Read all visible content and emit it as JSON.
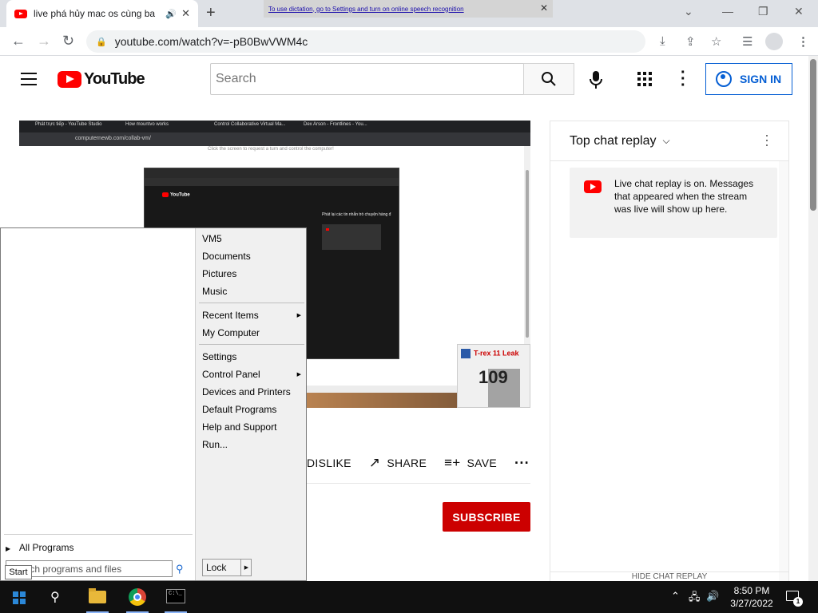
{
  "browser": {
    "tab_title": "live phá hủy mac os cùng ba",
    "dictation_notice": "To use dictation, go to Settings and turn on online speech recognition",
    "url": "youtube.com/watch?v=-pB0BwVWM4c"
  },
  "youtube": {
    "logo_text": "YouTube",
    "search_placeholder": "Search",
    "signin_label": "SIGN IN"
  },
  "video": {
    "inner_tabs": [
      "Phát trực tiếp - YouTube Studio",
      "How mountvo works",
      "Control Collaborative Virtual Ma...",
      "Dex Arson - Frontlines - You..."
    ],
    "inner_url": "computernewb.com/collab-vm/",
    "hint": "Click the screen to request a turn and control the computer!",
    "nested_yt_title": "Phát lại các tin nhắn trò chuyện hàng đ",
    "thumb_title": "T-rex 11 Leak",
    "thumb_number": "109"
  },
  "actions": {
    "dislike": "DISLIKE",
    "share": "SHARE",
    "save": "SAVE"
  },
  "subscribe_label": "SUBSCRIBE",
  "chat": {
    "header": "Top chat replay",
    "message": "Live chat replay is on. Messages that appeared when the stream was live will show up here.",
    "hide": "HIDE CHAT REPLAY"
  },
  "startmenu": {
    "group1": [
      "VM5",
      "Documents",
      "Pictures",
      "Music"
    ],
    "group2": [
      "Recent Items",
      "My Computer"
    ],
    "group3": [
      "Settings",
      "Control Panel",
      "Devices and Printers",
      "Default Programs",
      "Help and Support",
      "Run..."
    ],
    "all_programs": "All Programs",
    "search_placeholder": "Search programs and files",
    "lock_label": "Lock",
    "start_tooltip": "Start"
  },
  "taskbar": {
    "time": "8:50 PM",
    "date": "3/27/2022",
    "notification_count": "1"
  },
  "colors": {
    "yt_red": "#ff0000",
    "subscribe_red": "#cc0000",
    "signin_blue": "#065fd4"
  }
}
